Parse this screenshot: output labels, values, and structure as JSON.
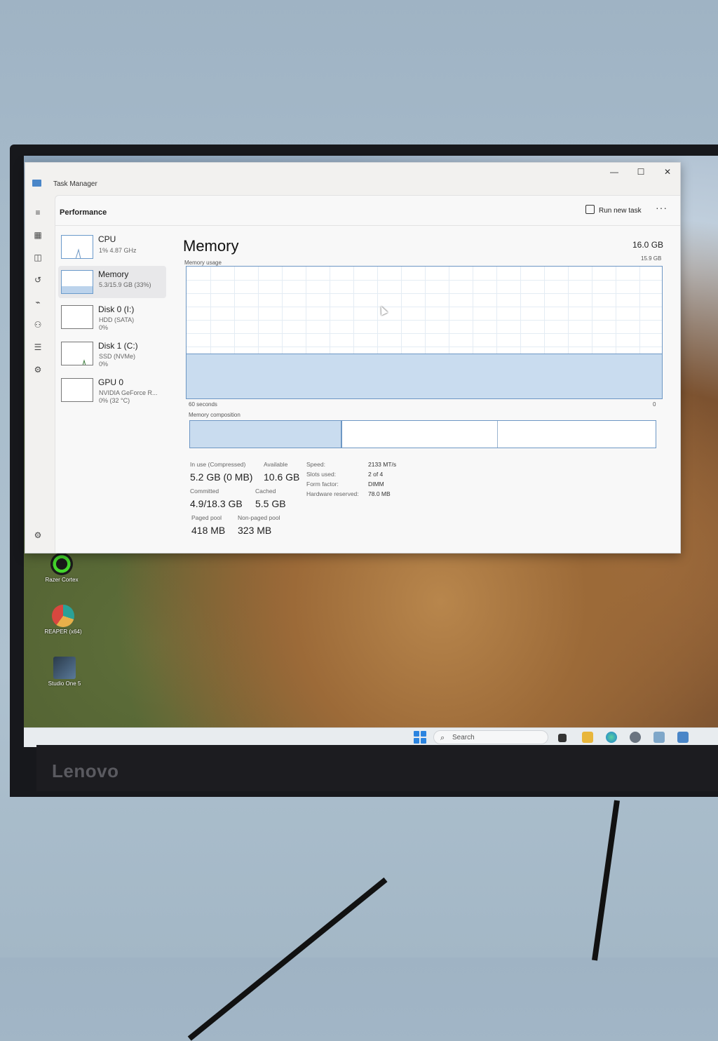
{
  "window": {
    "title": "Task Manager",
    "page_title": "Performance",
    "run_new_task": "Run new task",
    "more": "···",
    "minimize": "—",
    "maximize": "☐",
    "close": "✕"
  },
  "perf_items": [
    {
      "name": "CPU",
      "sub1": "1% 4.87 GHz",
      "sub2": ""
    },
    {
      "name": "Memory",
      "sub1": "5.3/15.9 GB (33%)",
      "sub2": ""
    },
    {
      "name": "Disk 0 (I:)",
      "sub1": "HDD (SATA)",
      "sub2": "0%"
    },
    {
      "name": "Disk 1 (C:)",
      "sub1": "SSD (NVMe)",
      "sub2": "0%"
    },
    {
      "name": "GPU 0",
      "sub1": "NVIDIA GeForce R...",
      "sub2": "0% (32 °C)"
    }
  ],
  "memory": {
    "title": "Memory",
    "total": "16.0 GB",
    "usage_label": "Memory usage",
    "usage_max": "15.9 GB",
    "usage_fraction": 0.33,
    "axis_left": "60 seconds",
    "axis_right": "0",
    "composition_label": "Memory composition",
    "stats": {
      "in_use_label": "In use (Compressed)",
      "in_use_value": "5.2 GB (0 MB)",
      "available_label": "Available",
      "available_value": "10.6 GB",
      "committed_label": "Committed",
      "committed_value": "4.9/18.3 GB",
      "cached_label": "Cached",
      "cached_value": "5.5 GB",
      "paged_label": "Paged pool",
      "paged_value": "418 MB",
      "nonpaged_label": "Non-paged pool",
      "nonpaged_value": "323 MB"
    },
    "specs": [
      {
        "key": "Speed:",
        "value": "2133 MT/s"
      },
      {
        "key": "Slots used:",
        "value": "2 of 4"
      },
      {
        "key": "Form factor:",
        "value": "DIMM"
      },
      {
        "key": "Hardware reserved:",
        "value": "78.0 MB"
      }
    ]
  },
  "desktop_icons": [
    {
      "label": "Razer Cortex"
    },
    {
      "label": "REAPER (x64)"
    },
    {
      "label": "Studio One 5"
    }
  ],
  "taskbar": {
    "search_placeholder": "Search"
  },
  "monitor_brand": "Lenovo",
  "colors": {
    "accent": "#6d97c4",
    "memory_fill": "#c9dcef",
    "windows_blue": "#2b84e0"
  }
}
